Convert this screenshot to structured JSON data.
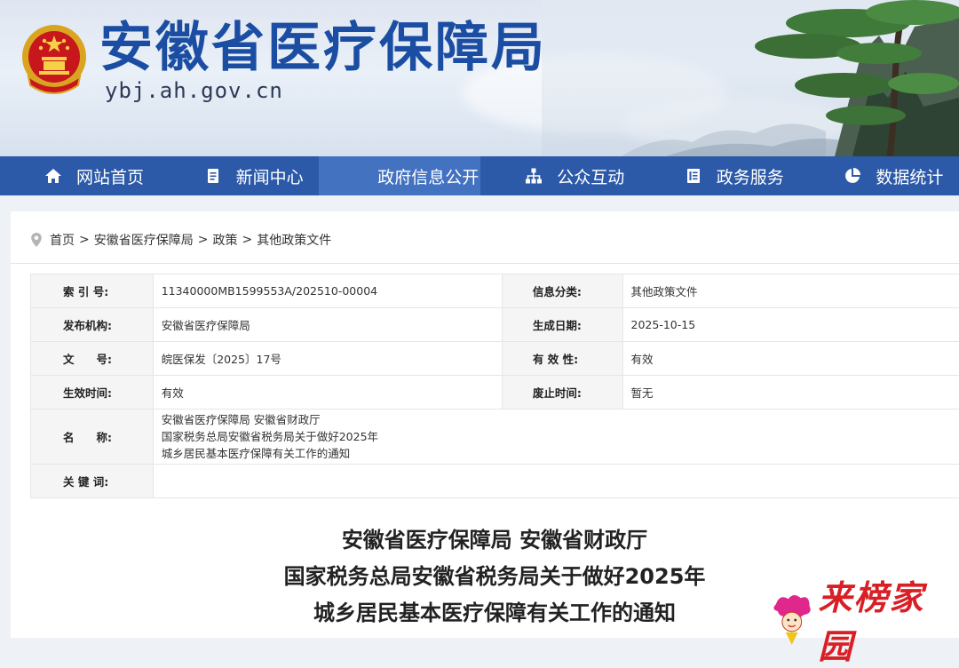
{
  "header": {
    "site_title": "安徽省医疗保障局",
    "site_url": "ybj.ah.gov.cn"
  },
  "nav": {
    "items": [
      {
        "label": "网站首页",
        "icon": "home-icon"
      },
      {
        "label": "新闻中心",
        "icon": "document-icon"
      },
      {
        "label": "政府信息公开",
        "icon": "screen-icon",
        "active": true
      },
      {
        "label": "公众互动",
        "icon": "network-icon"
      },
      {
        "label": "政务服务",
        "icon": "clipboard-icon"
      },
      {
        "label": "数据统计",
        "icon": "pie-chart-icon"
      }
    ]
  },
  "breadcrumb": {
    "items": [
      "首页",
      "安徽省医疗保障局",
      "政策",
      "其他政策文件"
    ],
    "separator": ">"
  },
  "meta": {
    "index_no_label": "索 引 号:",
    "index_no": "11340000MB1599553A/202510-00004",
    "category_label": "信息分类:",
    "category": "其他政策文件",
    "publisher_label": "发布机构:",
    "publisher": "安徽省医疗保障局",
    "date_label": "生成日期:",
    "date": "2025-10-15",
    "doc_no_label": "文　　号:",
    "doc_no": "皖医保发〔2025〕17号",
    "validity_label": "有 效 性:",
    "validity": "有效",
    "effective_label": "生效时间:",
    "effective": "有效",
    "repeal_label": "废止时间:",
    "repeal": "暂无",
    "name_label": "名　　称:",
    "name_line1": "安徽省医疗保障局 安徽省财政厅",
    "name_line2": "国家税务总局安徽省税务局关于做好2025年",
    "name_line3": "城乡居民基本医疗保障有关工作的通知",
    "keywords_label": "关 键 词:",
    "keywords": ""
  },
  "document": {
    "title_line1": "安徽省医疗保障局 安徽省财政厅",
    "title_line2": "国家税务总局安徽省税务局关于做好2025年",
    "title_line3": "城乡居民基本医疗保障有关工作的通知"
  },
  "watermark": {
    "text": "来榜家园"
  },
  "colors": {
    "brand_blue": "#1b4ea3",
    "nav_bg": "#2c5aa8",
    "nav_active": "#4272c0",
    "watermark_red": "#d81f26"
  }
}
